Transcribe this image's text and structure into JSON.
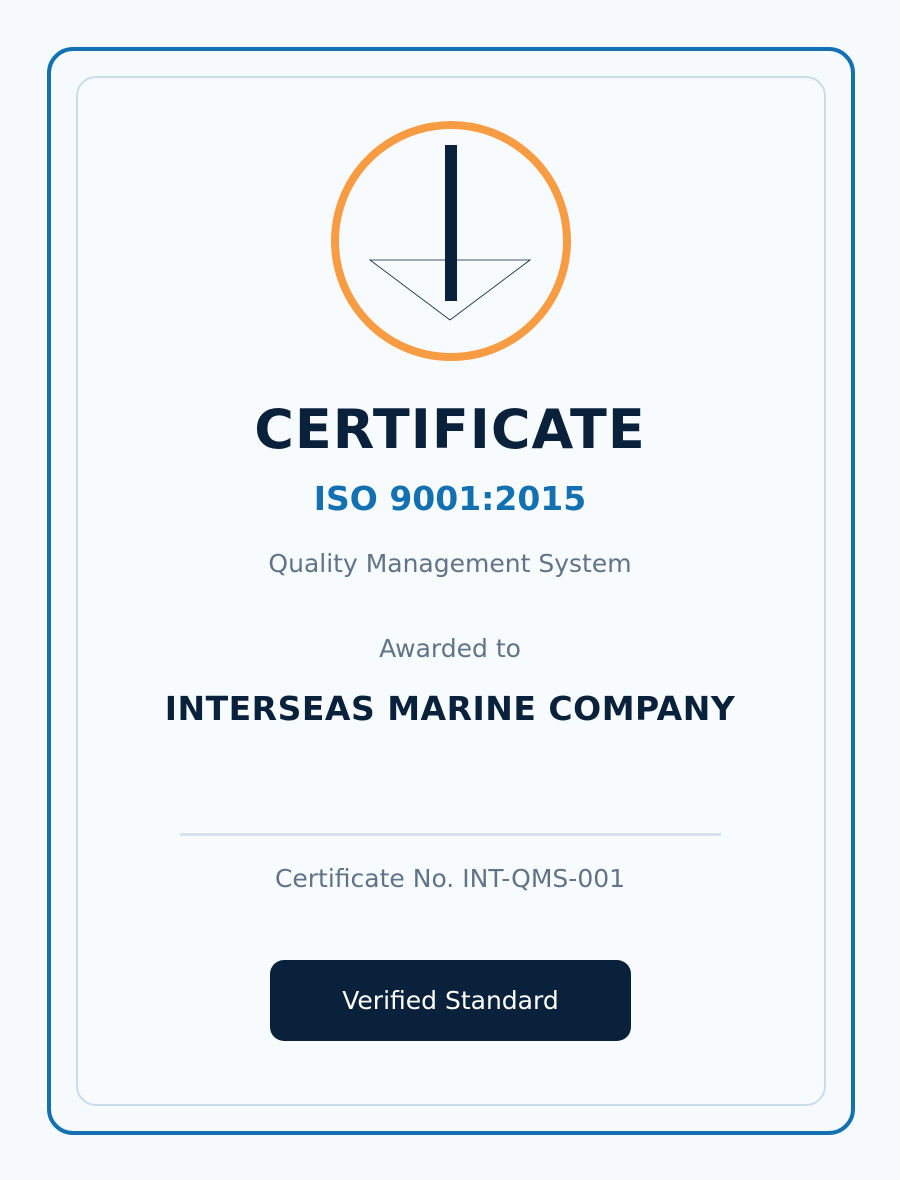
{
  "certificate": {
    "title": "CERTIFICATE",
    "standard": "ISO 9001:2015",
    "scope": "Quality Management System",
    "awarded_label": "Awarded to",
    "company": "INTERSEAS MARINE COMPANY",
    "certificate_number": "Certificate No. INT-QMS-001",
    "badge_label": "Verified Standard"
  },
  "icons": {
    "emblem": "anchor-icon"
  },
  "colors": {
    "frame": "#1471b1",
    "emblem_ring": "#f89c43",
    "navy": "#0a213b",
    "accent": "#1471b1",
    "muted_text": "#617386"
  }
}
